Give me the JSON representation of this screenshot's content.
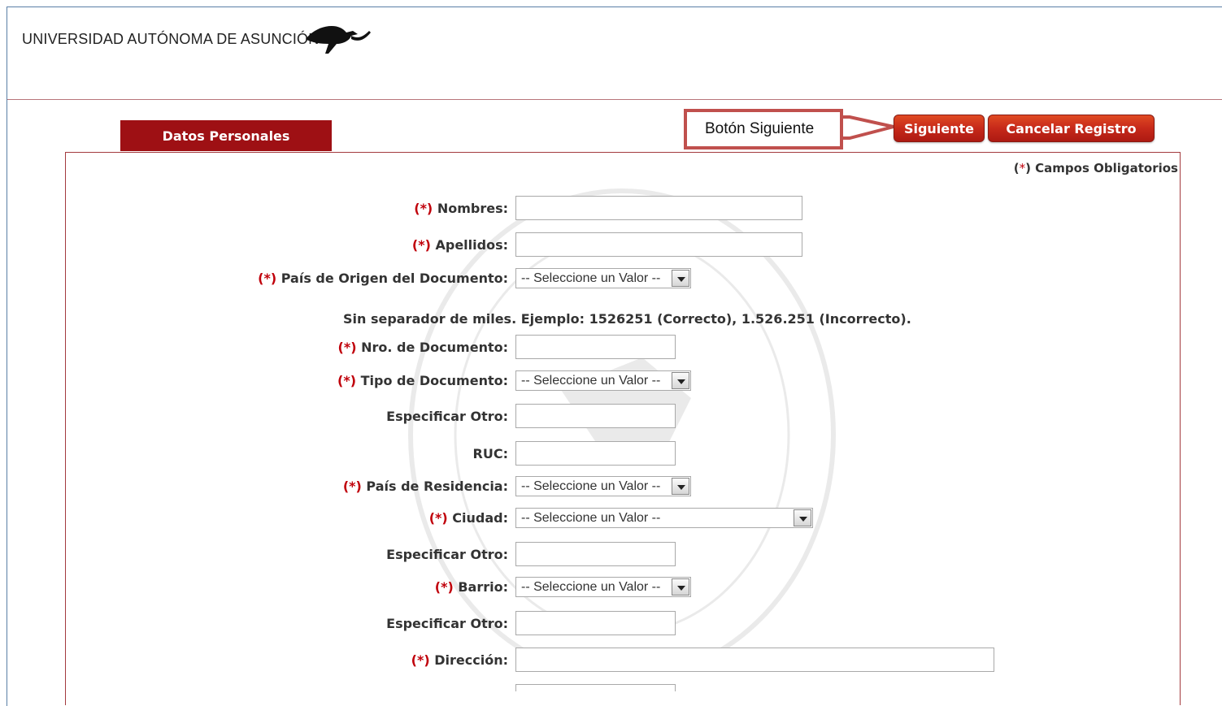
{
  "header": {
    "logo_text": "UNIVERSIDAD AUTÓNOMA DE ASUNCIÓN"
  },
  "tabs": {
    "datos_personales": "Datos Personales"
  },
  "toolbar": {
    "siguiente_label": "Siguiente",
    "cancelar_label": "Cancelar Registro"
  },
  "callout": {
    "text": "Botón Siguiente"
  },
  "form": {
    "required_star": "(*)",
    "required_star_char": "*",
    "required_note_text": "Campos Obligatorios",
    "hint": "Sin separador de miles. Ejemplo: 1526251 (Correcto), 1.526.251 (Incorrecto).",
    "select_placeholder": "-- Seleccione un Valor --",
    "fields": {
      "nombres": "Nombres:",
      "apellidos": "Apellidos:",
      "pais_origen": "País de Origen del Documento:",
      "nro_documento": "Nro. de Documento:",
      "tipo_documento": "Tipo de Documento:",
      "especificar_otro": "Especificar Otro:",
      "ruc": "RUC:",
      "pais_residencia": "País de Residencia:",
      "ciudad": "Ciudad:",
      "barrio": "Barrio:",
      "direccion": "Dirección:"
    }
  },
  "colors": {
    "brand_red": "#9e1014",
    "button_red": "#c6291a",
    "required_star": "#c0000b",
    "callout_border": "#c0504d"
  }
}
